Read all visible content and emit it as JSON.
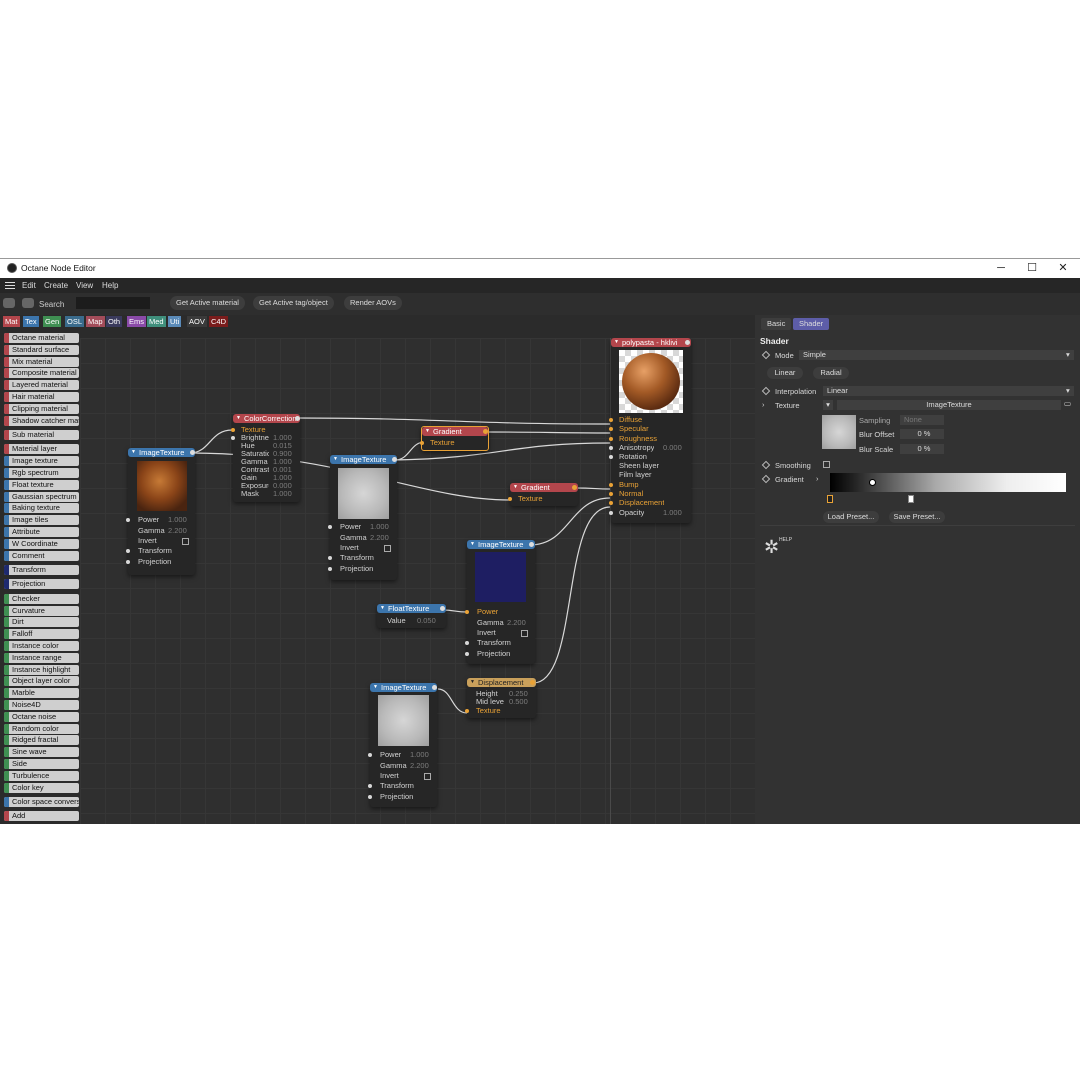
{
  "window": {
    "title": "Octane Node Editor",
    "minimize_glyph": "─",
    "maximize_glyph": "☐",
    "close_glyph": "✕"
  },
  "menubar": {
    "items": [
      "Edit",
      "Create",
      "View",
      "Help"
    ]
  },
  "toolbar": {
    "search_label": "Search",
    "search_value": "",
    "buttons": [
      "Get Active material",
      "Get Active tag/object",
      "Render AOVs"
    ]
  },
  "categories": [
    {
      "label": "Mat",
      "color": "#b3464c"
    },
    {
      "label": "Tex",
      "color": "#3c75ac"
    },
    {
      "label": "Gen",
      "color": "#3f8f52"
    },
    {
      "label": "OSL",
      "color": "#3a6b8c"
    },
    {
      "label": "Map",
      "color": "#a34c5a"
    },
    {
      "label": "Oth",
      "color": "#3a3a5c"
    },
    {
      "label": "Ems",
      "color": "#8a4aa8"
    },
    {
      "label": "Med",
      "color": "#3f8f7c"
    },
    {
      "label": "Uti",
      "color": "#5a8ab8"
    },
    {
      "label": "AOV",
      "color": "#3a3a3a"
    },
    {
      "label": "C4D",
      "color": "#7a1c1c"
    }
  ],
  "palette": [
    {
      "label": "Octane material",
      "color": "#b3464c"
    },
    {
      "label": "Standard surface",
      "color": "#b3464c"
    },
    {
      "label": "Mix material",
      "color": "#b3464c"
    },
    {
      "label": "Composite material",
      "color": "#b3464c"
    },
    {
      "label": "Layered material",
      "color": "#b3464c"
    },
    {
      "label": "Hair material",
      "color": "#b3464c"
    },
    {
      "label": "Clipping material",
      "color": "#b3464c"
    },
    {
      "label": "Shadow catcher material",
      "color": "#b3464c"
    },
    {
      "label": "Sub material",
      "color": "#b3464c"
    },
    {
      "label": "Material layer",
      "color": "#b3464c"
    },
    {
      "label": "Image texture",
      "color": "#3c75ac"
    },
    {
      "label": "Rgb spectrum",
      "color": "#3c75ac"
    },
    {
      "label": "Float texture",
      "color": "#3c75ac"
    },
    {
      "label": "Gaussian spectrum",
      "color": "#3c75ac"
    },
    {
      "label": "Baking texture",
      "color": "#3c75ac"
    },
    {
      "label": "Image tiles",
      "color": "#3c75ac"
    },
    {
      "label": "Attribute",
      "color": "#3c75ac"
    },
    {
      "label": "W Coordinate",
      "color": "#3c75ac"
    },
    {
      "label": "Comment",
      "color": "#3c75ac"
    },
    {
      "label": "Transform",
      "color": "#1e2a70"
    },
    {
      "label": "Projection",
      "color": "#1e2a70"
    },
    {
      "label": "Checker",
      "color": "#3f8f52"
    },
    {
      "label": "Curvature",
      "color": "#3f8f52"
    },
    {
      "label": "Dirt",
      "color": "#3f8f52"
    },
    {
      "label": "Falloff",
      "color": "#3f8f52"
    },
    {
      "label": "Instance color",
      "color": "#3f8f52"
    },
    {
      "label": "Instance range",
      "color": "#3f8f52"
    },
    {
      "label": "Instance highlight",
      "color": "#3f8f52"
    },
    {
      "label": "Object layer color",
      "color": "#3f8f52"
    },
    {
      "label": "Marble",
      "color": "#3f8f52"
    },
    {
      "label": "Noise4D",
      "color": "#3f8f52"
    },
    {
      "label": "Octane noise",
      "color": "#3f8f52"
    },
    {
      "label": "Random color",
      "color": "#3f8f52"
    },
    {
      "label": "Ridged fractal",
      "color": "#3f8f52"
    },
    {
      "label": "Sine wave",
      "color": "#3f8f52"
    },
    {
      "label": "Side",
      "color": "#3f8f52"
    },
    {
      "label": "Turbulence",
      "color": "#3f8f52"
    },
    {
      "label": "Color key",
      "color": "#3f8f52"
    },
    {
      "label": "Color space conversion",
      "color": "#3c75ac"
    },
    {
      "label": "Add",
      "color": "#b3464c"
    }
  ],
  "nodes": {
    "image_texture_1": {
      "title": "ImageTexture",
      "params": [
        {
          "label": "Power",
          "value": "1.000"
        },
        {
          "label": "Gamma",
          "value": "2.200"
        },
        {
          "label": "Invert",
          "value": ""
        },
        {
          "label": "Transform",
          "value": ""
        },
        {
          "label": "Projection",
          "value": ""
        }
      ]
    },
    "color_correction": {
      "title": "ColorCorrection",
      "params": [
        {
          "label": "Texture",
          "value": ""
        },
        {
          "label": "Brightness",
          "value": "1.000"
        },
        {
          "label": "Hue",
          "value": "0.015"
        },
        {
          "label": "Saturation",
          "value": "0.900"
        },
        {
          "label": "Gamma",
          "value": "1.000"
        },
        {
          "label": "Contrast",
          "value": "0.001"
        },
        {
          "label": "Gain",
          "value": "1.000"
        },
        {
          "label": "Exposure",
          "value": "0.000"
        },
        {
          "label": "Mask",
          "value": "1.000"
        }
      ]
    },
    "image_texture_2": {
      "title": "ImageTexture",
      "params": [
        {
          "label": "Power",
          "value": "1.000"
        },
        {
          "label": "Gamma",
          "value": "2.200"
        },
        {
          "label": "Invert",
          "value": ""
        },
        {
          "label": "Transform",
          "value": ""
        },
        {
          "label": "Projection",
          "value": ""
        }
      ]
    },
    "gradient_1": {
      "title": "Gradient",
      "params": [
        {
          "label": "Texture",
          "value": ""
        }
      ]
    },
    "gradient_2": {
      "title": "Gradient",
      "params": [
        {
          "label": "Texture",
          "value": ""
        }
      ]
    },
    "material": {
      "title": "polypasta - hklivi",
      "params": [
        {
          "label": "Diffuse",
          "value": ""
        },
        {
          "label": "Specular",
          "value": ""
        },
        {
          "label": "Roughness",
          "value": ""
        },
        {
          "label": "Anisotropy",
          "value": "0.000"
        },
        {
          "label": "Rotation",
          "value": ""
        },
        {
          "label": "Sheen layer",
          "value": ""
        },
        {
          "label": "Film layer",
          "value": ""
        },
        {
          "label": "Bump",
          "value": ""
        },
        {
          "label": "Normal",
          "value": ""
        },
        {
          "label": "Displacement",
          "value": ""
        },
        {
          "label": "Opacity",
          "value": "1.000"
        }
      ]
    },
    "image_texture_3": {
      "title": "ImageTexture",
      "params": [
        {
          "label": "Power",
          "value": ""
        },
        {
          "label": "Gamma",
          "value": "2.200"
        },
        {
          "label": "Invert",
          "value": ""
        },
        {
          "label": "Transform",
          "value": ""
        },
        {
          "label": "Projection",
          "value": ""
        }
      ]
    },
    "float_texture": {
      "title": "FloatTexture",
      "params": [
        {
          "label": "Value",
          "value": "0.050"
        }
      ]
    },
    "image_texture_4": {
      "title": "ImageTexture",
      "params": [
        {
          "label": "Power",
          "value": "1.000"
        },
        {
          "label": "Gamma",
          "value": "2.200"
        },
        {
          "label": "Invert",
          "value": ""
        },
        {
          "label": "Transform",
          "value": ""
        },
        {
          "label": "Projection",
          "value": ""
        }
      ]
    },
    "displacement": {
      "title": "Displacement",
      "params": [
        {
          "label": "Height",
          "value": "0.250"
        },
        {
          "label": "Mid level",
          "value": "0.500"
        },
        {
          "label": "Texture",
          "value": ""
        }
      ]
    }
  },
  "right_panel": {
    "tabs": [
      "Basic",
      "Shader"
    ],
    "active_tab": "Shader",
    "section_title": "Shader",
    "mode_label": "Mode",
    "mode_value": "Simple",
    "type_buttons": [
      "Linear",
      "Radial"
    ],
    "interpolation_label": "Interpolation",
    "interpolation_value": "Linear",
    "texture_label": "Texture",
    "texture_value": "ImageTexture",
    "sampling_label": "Sampling",
    "sampling_value": "None",
    "blur_offset_label": "Blur Offset",
    "blur_offset_value": "0 %",
    "blur_scale_label": "Blur Scale",
    "blur_scale_value": "0 %",
    "smoothing_label": "Smoothing",
    "gradient_label": "Gradient",
    "load_preset": "Load Preset...",
    "save_preset": "Save Preset...",
    "help_label": "HELP"
  }
}
